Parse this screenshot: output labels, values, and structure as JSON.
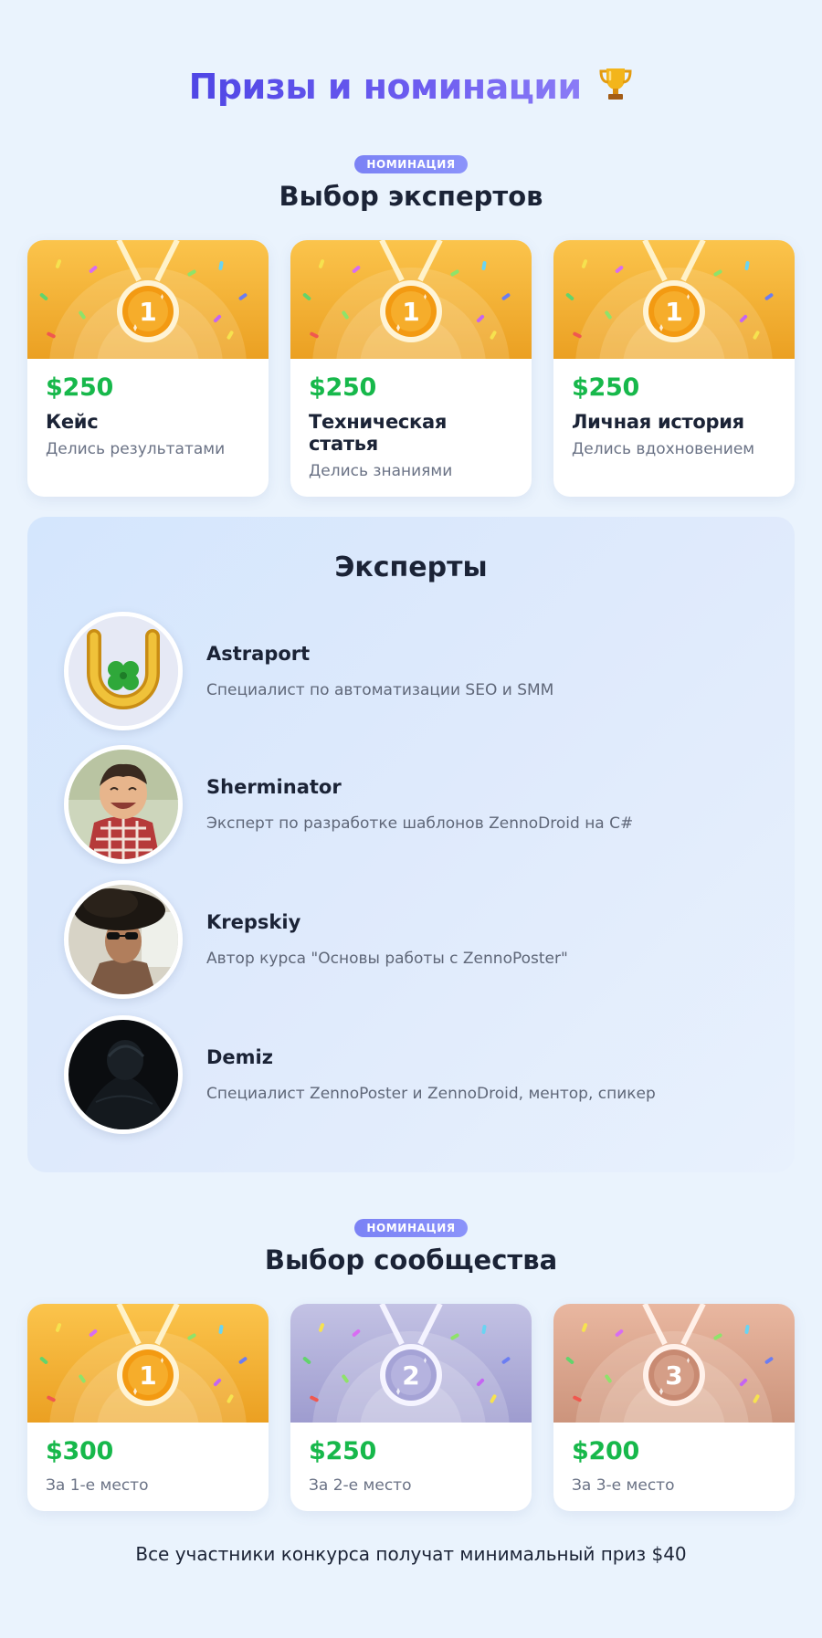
{
  "page": {
    "title": "Призы и номинации",
    "title_icon": "trophy-icon"
  },
  "experts_choice": {
    "badge": "номинация",
    "title": "Выбор экспертов",
    "cards": [
      {
        "prize": "$250",
        "title": "Кейс",
        "subtitle": "Делись результатами",
        "medal": "1",
        "theme": "gold"
      },
      {
        "prize": "$250",
        "title": "Техническая статья",
        "subtitle": "Делись знаниями",
        "medal": "1",
        "theme": "gold"
      },
      {
        "prize": "$250",
        "title": "Личная история",
        "subtitle": "Делись вдохновением",
        "medal": "1",
        "theme": "gold"
      }
    ]
  },
  "experts": {
    "title": "Эксперты",
    "list": [
      {
        "name": "Astraport",
        "description": "Специалист по автоматизации SEO и SMM",
        "avatar": "horseshoe-clover"
      },
      {
        "name": "Sherminator",
        "description": "Эксперт по разработке шаблонов ZennoDroid на C#",
        "avatar": "laughing-child-photo"
      },
      {
        "name": "Krepskiy",
        "description": "Автор курса \"Основы работы с ZennoPoster\"",
        "avatar": "man-in-hat-sunglasses-photo"
      },
      {
        "name": "Demiz",
        "description": "Специалист ZennoPoster и ZennoDroid, ментор, спикер",
        "avatar": "dark-hooded-figure-photo"
      }
    ]
  },
  "community_choice": {
    "badge": "номинация",
    "title": "Выбор сообщества",
    "cards": [
      {
        "prize": "$300",
        "subtitle": "За 1-е место",
        "medal": "1",
        "theme": "gold"
      },
      {
        "prize": "$250",
        "subtitle": "За 2-е место",
        "medal": "2",
        "theme": "silver"
      },
      {
        "prize": "$200",
        "subtitle": "За 3-е место",
        "medal": "3",
        "theme": "bronze"
      }
    ]
  },
  "footer": {
    "note": "Все участники конкурса получат минимальный приз $40"
  },
  "colors": {
    "accent": "#4f46e5",
    "prize_green": "#17b84b",
    "gold": "#f2ac2c",
    "silver": "#9d9bd0",
    "bronze": "#d49a84"
  }
}
